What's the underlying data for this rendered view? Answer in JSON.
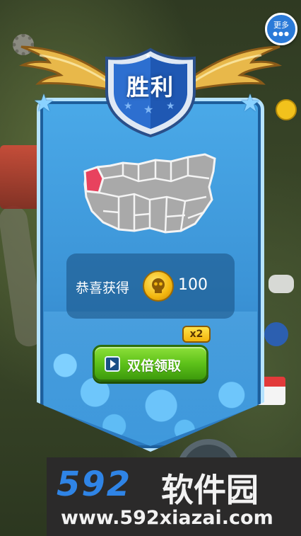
{
  "header": {
    "more_label": "更多",
    "more_dots": "●●●"
  },
  "banner": {
    "title": "胜利",
    "map_highlight_color": "#e8425e",
    "map_fill_color": "#a9a9a9"
  },
  "reward": {
    "label": "恭喜获得",
    "icon": "skull-coin-icon",
    "amount": "100"
  },
  "action": {
    "button_label": "双倍领取",
    "badge": "x2",
    "icon": "video-play-icon"
  },
  "watermark": {
    "brand_number": "592",
    "brand_text": "软件园",
    "url": "www.592xiazai.com"
  },
  "colors": {
    "banner_blue": "#3b93d6",
    "button_green": "#5ec21a",
    "coin_gold": "#f2b60f"
  }
}
